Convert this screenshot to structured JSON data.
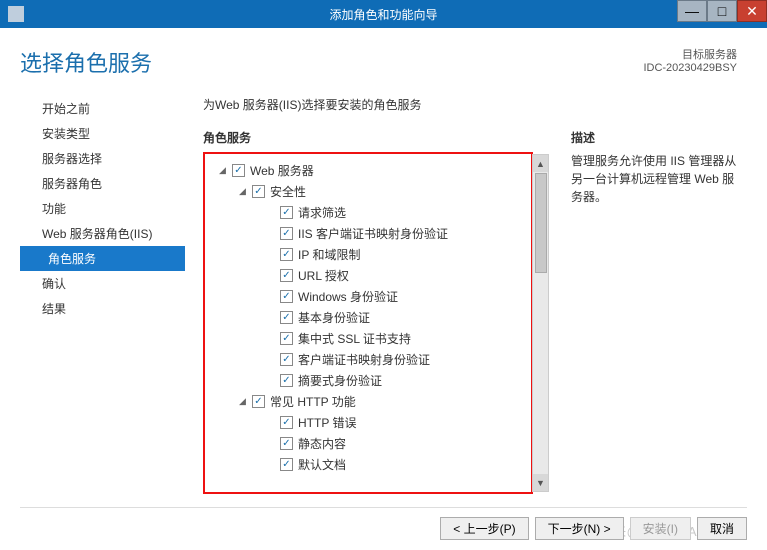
{
  "window": {
    "title": "添加角色和功能向导"
  },
  "header": {
    "title": "选择角色服务",
    "target_label": "目标服务器",
    "target_value": "IDC-20230429BSY"
  },
  "nav": {
    "items": [
      {
        "label": "开始之前",
        "active": false
      },
      {
        "label": "安装类型",
        "active": false
      },
      {
        "label": "服务器选择",
        "active": false
      },
      {
        "label": "服务器角色",
        "active": false
      },
      {
        "label": "功能",
        "active": false
      },
      {
        "label": "Web 服务器角色(IIS)",
        "active": false
      },
      {
        "label": "角色服务",
        "active": true
      },
      {
        "label": "确认",
        "active": false
      },
      {
        "label": "结果",
        "active": false
      }
    ]
  },
  "main": {
    "instruction": "为Web 服务器(IIS)选择要安装的角色服务",
    "tree_header": "角色服务",
    "desc_header": "描述",
    "desc_text": "管理服务允许使用 IIS 管理器从另一台计算机远程管理 Web 服务器。"
  },
  "tree": [
    {
      "level": 0,
      "expander": "◢",
      "checked": true,
      "label": "Web 服务器"
    },
    {
      "level": 1,
      "expander": "◢",
      "checked": true,
      "label": "安全性"
    },
    {
      "level": 2,
      "expander": "",
      "checked": true,
      "label": "请求筛选"
    },
    {
      "level": 2,
      "expander": "",
      "checked": true,
      "label": "IIS 客户端证书映射身份验证"
    },
    {
      "level": 2,
      "expander": "",
      "checked": true,
      "label": "IP 和域限制"
    },
    {
      "level": 2,
      "expander": "",
      "checked": true,
      "label": "URL 授权"
    },
    {
      "level": 2,
      "expander": "",
      "checked": true,
      "label": "Windows 身份验证"
    },
    {
      "level": 2,
      "expander": "",
      "checked": true,
      "label": "基本身份验证"
    },
    {
      "level": 2,
      "expander": "",
      "checked": true,
      "label": "集中式 SSL 证书支持"
    },
    {
      "level": 2,
      "expander": "",
      "checked": true,
      "label": "客户端证书映射身份验证"
    },
    {
      "level": 2,
      "expander": "",
      "checked": true,
      "label": "摘要式身份验证"
    },
    {
      "level": 1,
      "expander": "◢",
      "checked": true,
      "label": "常见 HTTP 功能"
    },
    {
      "level": 2,
      "expander": "",
      "checked": true,
      "label": "HTTP 错误"
    },
    {
      "level": 2,
      "expander": "",
      "checked": true,
      "label": "静态内容"
    },
    {
      "level": 2,
      "expander": "",
      "checked": true,
      "label": "默认文档"
    }
  ],
  "footer": {
    "prev": "< 上一步(P)",
    "next": "下一步(N) >",
    "install": "安装(I)",
    "cancel": "取消"
  },
  "watermark": "CSDN来@IDC02YA"
}
